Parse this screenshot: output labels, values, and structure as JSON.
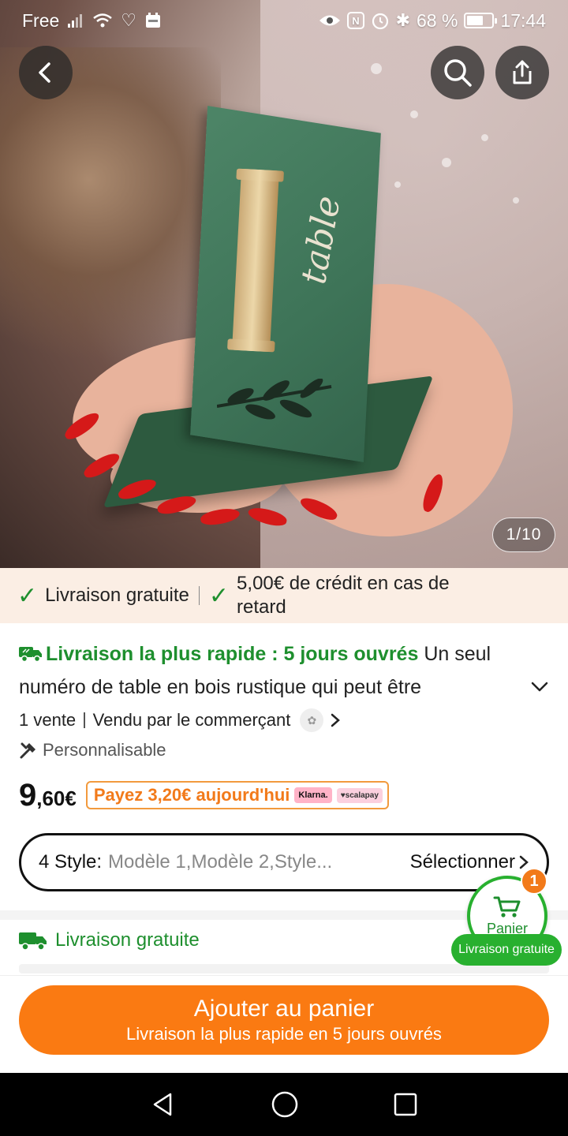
{
  "status_bar": {
    "carrier": "Free",
    "battery": "68 %",
    "battery_level": 0.68,
    "time": "17:44"
  },
  "gallery": {
    "counter": "1/10",
    "image_text": "table"
  },
  "promo": {
    "free_shipping": "Livraison gratuite",
    "credit": "5,00€ de crédit en cas de retard"
  },
  "description": {
    "fast_delivery": "Livraison la plus rapide : 5 jours ouvrés",
    "text": "Un seul numéro de table en bois rustique qui peut être"
  },
  "seller": {
    "sales": "1 vente",
    "sold_by": "Vendu par le commerçant"
  },
  "customizable": "Personnalisable",
  "price": {
    "integer": "9",
    "decimal": ",60€",
    "pay_today": "Payez 3,20€ aujourd'hui",
    "klarna": "Klarna.",
    "scalapay": "♥scalapay"
  },
  "style_selector": {
    "label": "4 Style:",
    "value": "Modèle 1,Modèle 2,Style...",
    "action": "Sélectionner"
  },
  "shipping": {
    "label": "Livraison gratuite"
  },
  "cart": {
    "label": "Panier",
    "count": "1",
    "shipping": "Livraison gratuite"
  },
  "add_to_cart": {
    "title": "Ajouter au panier",
    "subtitle": "Livraison la plus rapide en 5 jours ouvrés"
  },
  "colors": {
    "accent_orange": "#fa7a12",
    "green": "#1e8f2e",
    "promo_bg": "#fbeee4"
  }
}
